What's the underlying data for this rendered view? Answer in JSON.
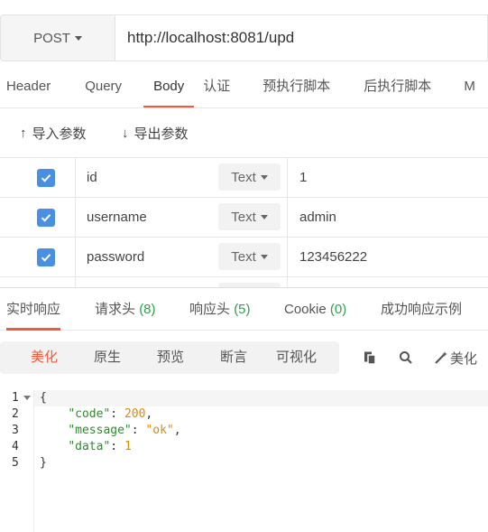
{
  "request": {
    "method": "POST",
    "url": "http://localhost:8081/upd"
  },
  "tabs": [
    {
      "label": "Header"
    },
    {
      "label": "Query"
    },
    {
      "label": "Body",
      "active": true
    },
    {
      "label": "认证"
    },
    {
      "label": "预执行脚本"
    },
    {
      "label": "后执行脚本"
    },
    {
      "label": "M"
    }
  ],
  "params_toolbar": {
    "import_label": "导入参数",
    "export_label": "导出参数"
  },
  "params": [
    {
      "checked": true,
      "name": "id",
      "type": "Text",
      "value": "1"
    },
    {
      "checked": true,
      "name": "username",
      "type": "Text",
      "value": "admin"
    },
    {
      "checked": true,
      "name": "password",
      "type": "Text",
      "value": "123456222"
    },
    {
      "checked": true,
      "name": "",
      "type": "",
      "value": ""
    }
  ],
  "response_tabs": {
    "realtime": "实时响应",
    "req_headers": "请求头",
    "req_headers_count": "(8)",
    "resp_headers": "响应头",
    "resp_headers_count": "(5)",
    "cookie": "Cookie",
    "cookie_count": "(0)",
    "success_example": "成功响应示例"
  },
  "view_modes": {
    "beautify": "美化",
    "raw": "原生",
    "preview": "预览",
    "assert": "断言",
    "visualize": "可视化"
  },
  "tools": {
    "copy_icon": "copy-icon",
    "search_icon": "search-icon",
    "beautify_label": "美化"
  },
  "response_code": {
    "line_numbers": [
      "1",
      "2",
      "3",
      "4",
      "5"
    ],
    "open_brace": "{",
    "close_brace": "}",
    "fields": [
      {
        "key": "\"code\"",
        "sep": ": ",
        "value": "200",
        "comma": ","
      },
      {
        "key": "\"message\"",
        "sep": ": ",
        "value": "\"ok\"",
        "comma": ","
      },
      {
        "key": "\"data\"",
        "sep": ": ",
        "value": "1",
        "comma": ""
      }
    ]
  },
  "colors": {
    "accent": "#f15a3c",
    "checkbox": "#4a90e2",
    "count_green": "#2e9f4c",
    "json_key": "#2e8b2e",
    "json_value": "#e08a00"
  }
}
